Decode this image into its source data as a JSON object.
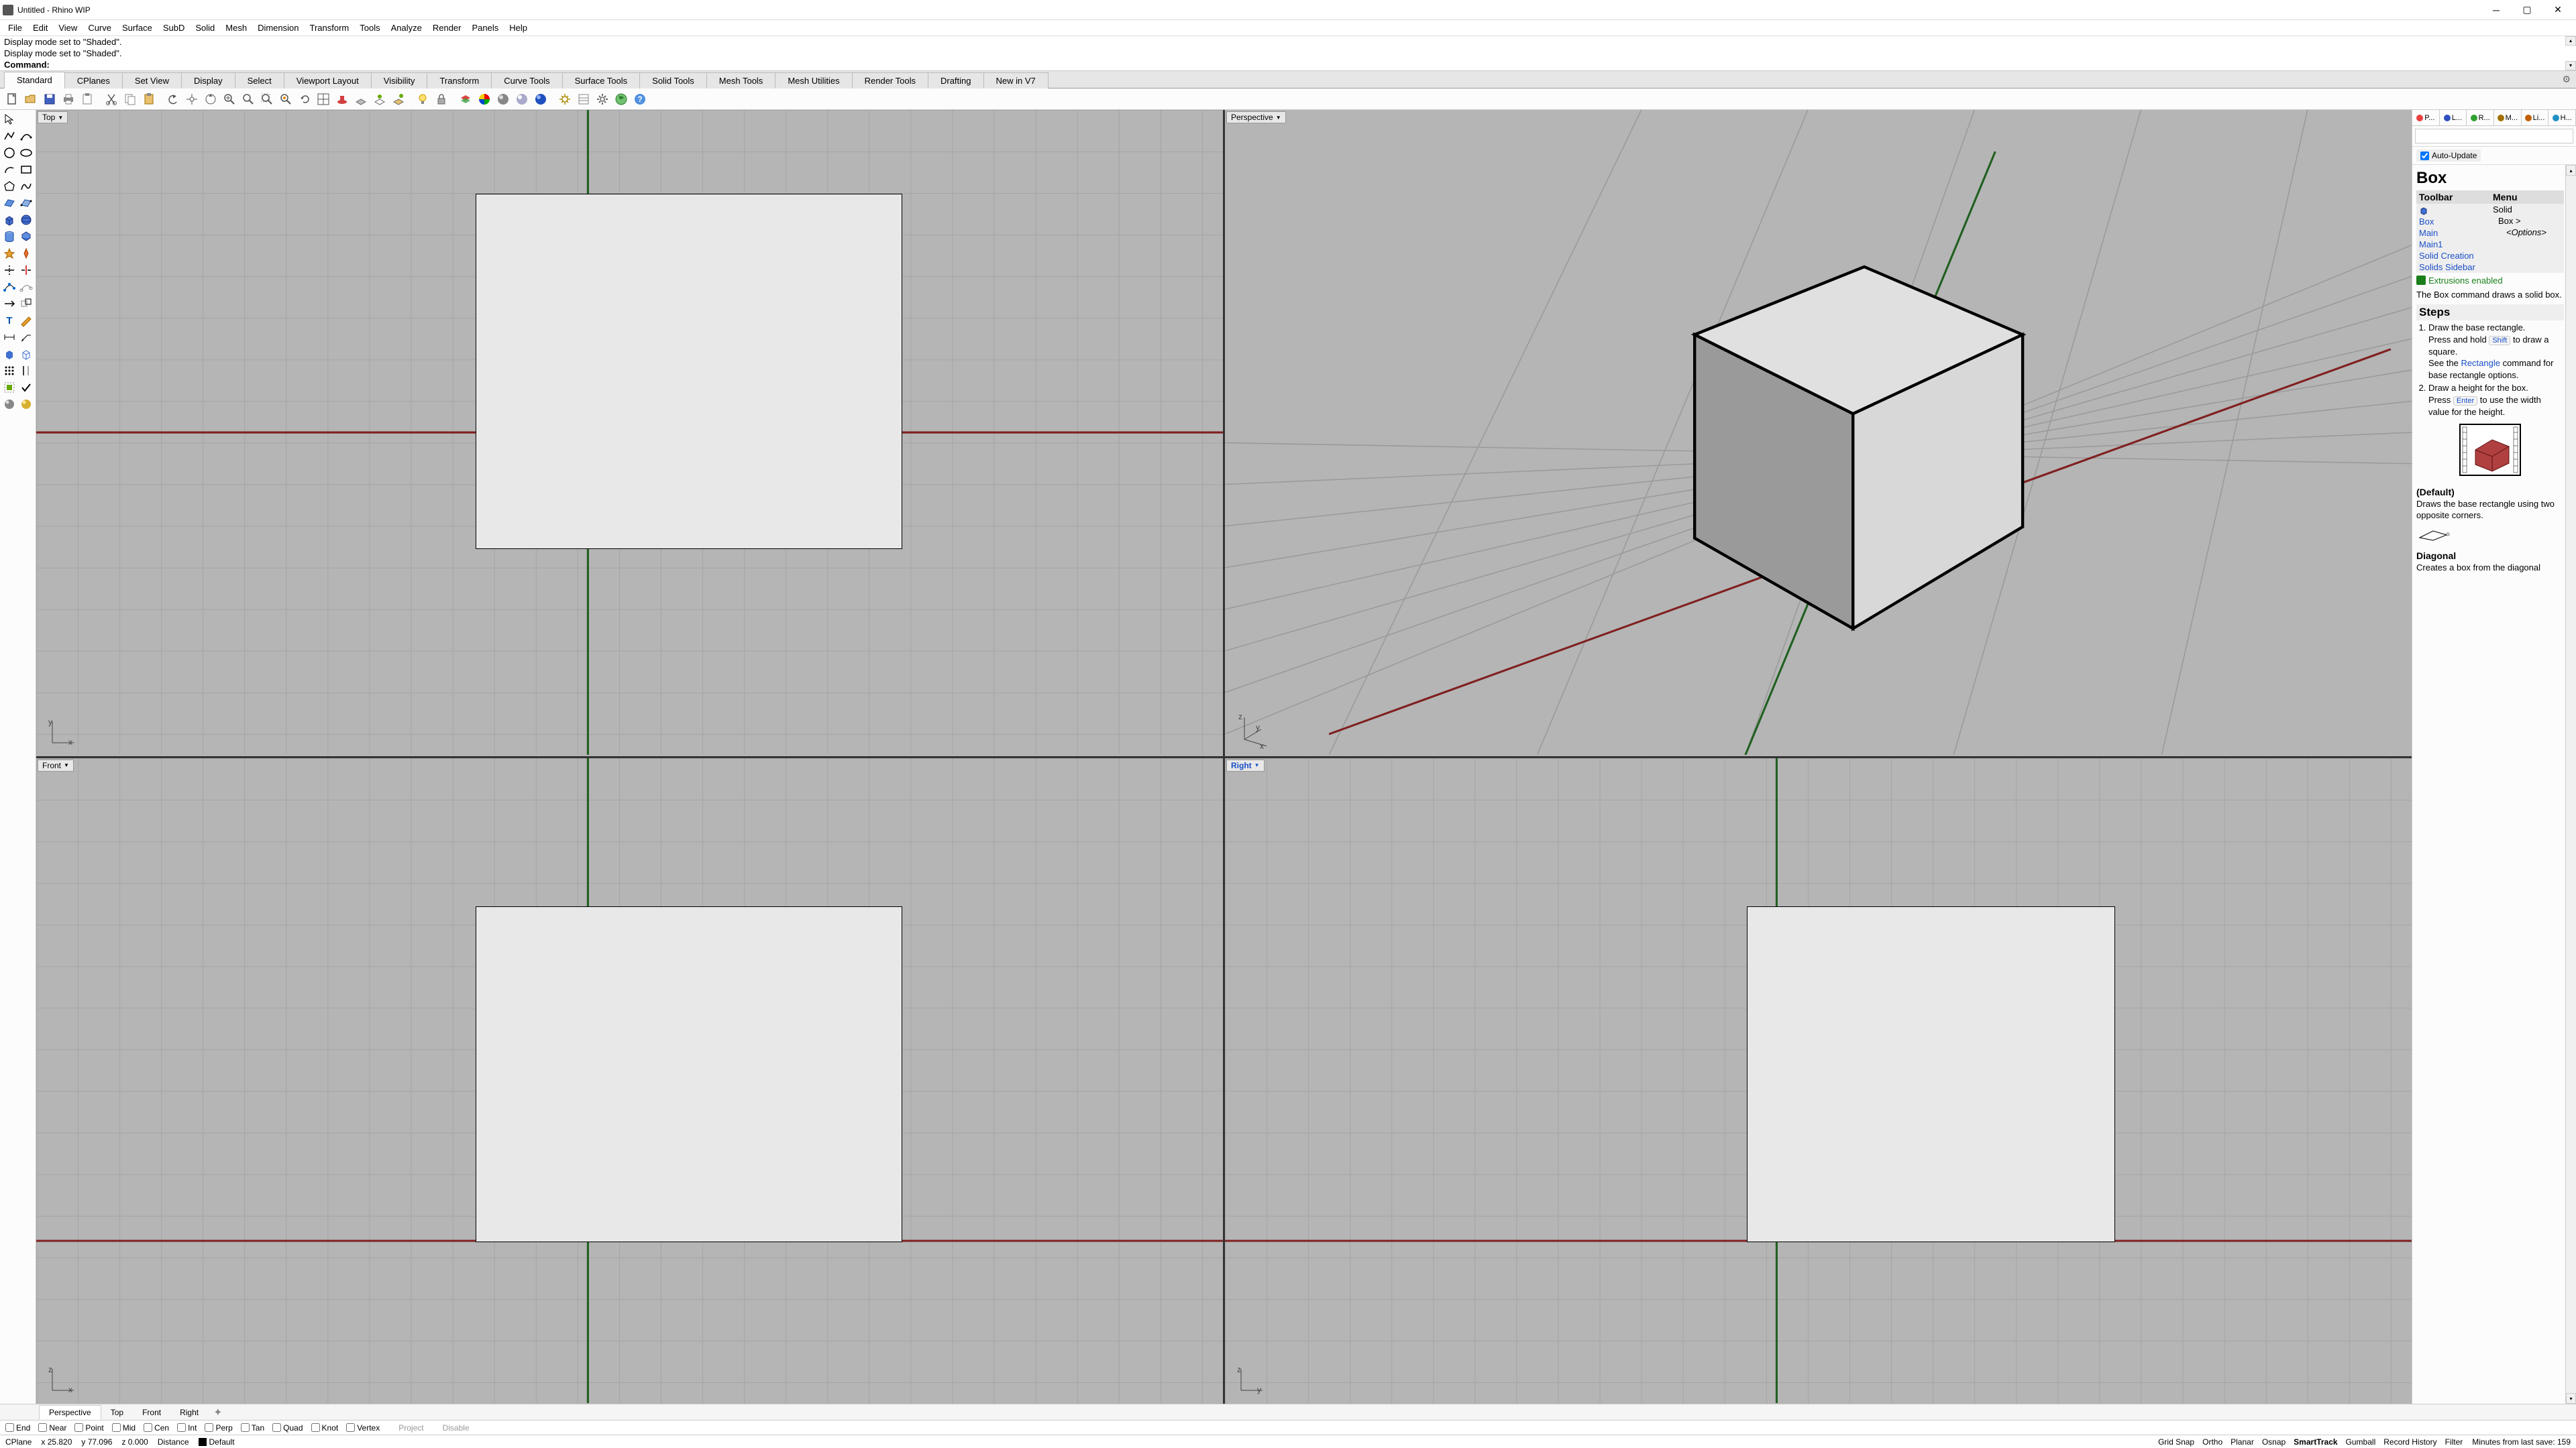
{
  "titlebar": {
    "title": "Untitled - Rhino WIP"
  },
  "menu": [
    "File",
    "Edit",
    "View",
    "Curve",
    "Surface",
    "SubD",
    "Solid",
    "Mesh",
    "Dimension",
    "Transform",
    "Tools",
    "Analyze",
    "Render",
    "Panels",
    "Help"
  ],
  "cmd": {
    "hist1": "Display mode set to \"Shaded\".",
    "hist2": "Display mode set to \"Shaded\".",
    "prompt": "Command:"
  },
  "tabs": [
    "Standard",
    "CPlanes",
    "Set View",
    "Display",
    "Select",
    "Viewport Layout",
    "Visibility",
    "Transform",
    "Curve Tools",
    "Surface Tools",
    "Solid Tools",
    "Mesh Tools",
    "Mesh Utilities",
    "Render Tools",
    "Drafting",
    "New in V7"
  ],
  "active_tab": 0,
  "viewports": {
    "top": "Top",
    "persp": "Perspective",
    "front": "Front",
    "right": "Right"
  },
  "rightpanel": {
    "tabs": [
      {
        "label": "P...",
        "color": "#e84040"
      },
      {
        "label": "L...",
        "color": "#3050c0"
      },
      {
        "label": "R...",
        "color": "#30a030"
      },
      {
        "label": "M...",
        "color": "#a07000"
      },
      {
        "label": "Li...",
        "color": "#c06000"
      },
      {
        "label": "H...",
        "color": "#2090c0"
      }
    ],
    "auto_update": "Auto-Update",
    "title": "Box",
    "toolbar_hdr": "Toolbar",
    "menu_hdr": "Menu",
    "toolbar_items": [
      "Box",
      "Main",
      "Main1",
      "Solid Creation",
      "Solids Sidebar"
    ],
    "menu_items": [
      "Solid",
      "Box >",
      "<Options>"
    ],
    "extrusions": "Extrusions enabled",
    "desc": "The Box command draws a solid box.",
    "steps_hdr": "Steps",
    "step1a": "Draw the base rectangle.",
    "step1b_pre": "Press and hold ",
    "step1b_kbd": "Shift",
    "step1b_post": " to draw a square.",
    "step1c_pre": "See the ",
    "step1c_lnk": "Rectangle",
    "step1c_post": " command for base rectangle options.",
    "step2a": "Draw a height for the box.",
    "step2b_pre": "Press ",
    "step2b_kbd": "Enter",
    "step2b_post": " to use the width value for the height.",
    "default_hdr": "(Default)",
    "default_txt": "Draws the base rectangle using two opposite corners.",
    "diag_hdr": "Diagonal",
    "diag_txt": "Creates a box from the diagonal"
  },
  "vtabs": [
    "Perspective",
    "Top",
    "Front",
    "Right"
  ],
  "osnap": [
    "End",
    "Near",
    "Point",
    "Mid",
    "Cen",
    "Int",
    "Perp",
    "Tan",
    "Quad",
    "Knot",
    "Vertex"
  ],
  "osnap_extra": [
    "Project",
    "Disable"
  ],
  "status": {
    "cplane": "CPlane",
    "x": "x 25.820",
    "y": "y 77.096",
    "z": "z 0.000",
    "dist": "Distance",
    "default": "Default",
    "toggles": [
      "Grid Snap",
      "Ortho",
      "Planar",
      "Osnap",
      "SmartTrack",
      "Gumball",
      "Record History",
      "Filter"
    ],
    "save": "Minutes from last save: 159"
  }
}
